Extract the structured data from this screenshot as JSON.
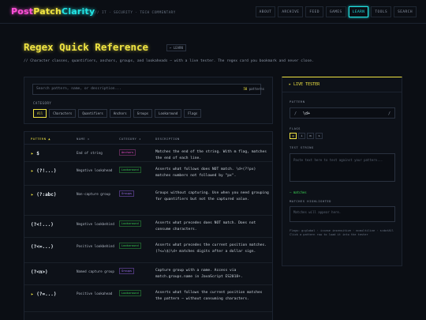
{
  "header": {
    "logo_part1": "Post",
    "logo_part2": "Patch",
    "logo_part3": "Clarity",
    "tagline": "// IT · SECURITY · TECH COMMENTARY",
    "nav": [
      "ABOUT",
      "ARCHIVE",
      "FEED",
      "GAMES",
      "LEARN",
      "TOOLS",
      "SEARCH"
    ],
    "active_nav": "LEARN"
  },
  "page": {
    "title": "Regex Quick Reference",
    "tag": "← LEARN",
    "subtitle": "// Character classes, quantifiers, anchors, groups, and lookaheads — with a live tester. The regex card you bookmark and never close."
  },
  "search": {
    "placeholder": "Search pattern, name, or description...",
    "count": "58",
    "count_label": "patterns",
    "category_label": "CATEGORY",
    "categories": [
      "All",
      "Characters",
      "Quantifiers",
      "Anchors",
      "Groups",
      "Lookaround",
      "Flags"
    ],
    "active_category": "All"
  },
  "table": {
    "headers": {
      "pattern": "PATTERN ▲",
      "name": "NAME ↕",
      "category": "CATEGORY ↕",
      "description": "DESCRIPTION"
    },
    "rows": [
      {
        "pattern": "$",
        "name": "End of string",
        "category": "Anchors",
        "cat_class": "anchors",
        "description": "Matches the end of the string. With m flag, matches the end of each line."
      },
      {
        "pattern": "(?!...)",
        "name": "Negative lookahead",
        "category": "Lookaround",
        "cat_class": "lookaround",
        "description": "Asserts what follows does NOT match. \\d+(?!px) matches numbers not followed by \"px\"."
      },
      {
        "pattern": "(?:abc)",
        "name": "Non-capture group",
        "category": "Groups",
        "cat_class": "groups",
        "description": "Groups without capturing. Use when you need grouping for quantifiers but not the captured value."
      },
      {
        "pattern": "(?<!...)",
        "name": "Negative lookbehind",
        "category": "Lookaround",
        "cat_class": "lookaround",
        "description": "Asserts what precedes does NOT match. Does not consume characters."
      },
      {
        "pattern": "(?<=...)",
        "name": "Positive lookbehind",
        "category": "Lookaround",
        "cat_class": "lookaround",
        "description": "Asserts what precedes the current position matches. (?<=\\$)\\d+ matches digits after a dollar sign."
      },
      {
        "pattern": "(?<n>)",
        "name": "Named capture group",
        "category": "Groups",
        "cat_class": "groups",
        "description": "Capture group with a name. Access via match.groups.name in JavaScript ES2018+."
      },
      {
        "pattern": "(?=...)",
        "name": "Positive lookahead",
        "category": "Lookaround",
        "cat_class": "lookaround",
        "description": "Asserts what follows the current position matches the pattern — without consuming characters."
      }
    ]
  },
  "tester": {
    "title": "▸ LIVE TESTER",
    "pattern_label": "PATTERN",
    "slash_open": "/",
    "pattern_value": "\\d+",
    "slash_close": "/",
    "flags_label": "FLAGS",
    "flags": [
      "g",
      "i",
      "m",
      "s"
    ],
    "active_flag": "g",
    "test_label": "TEST STRING",
    "test_placeholder": "Paste text here to test against your pattern...",
    "matches_text": "— matches",
    "highlight_label": "MATCHES HIGHLIGHTED",
    "highlight_placeholder": "Matches will appear here.",
    "help_line1": "Flags: g=global · i=case insensitive · m=multiline · s=dotAll",
    "help_line2": "Click a pattern row to load it into the tester"
  }
}
